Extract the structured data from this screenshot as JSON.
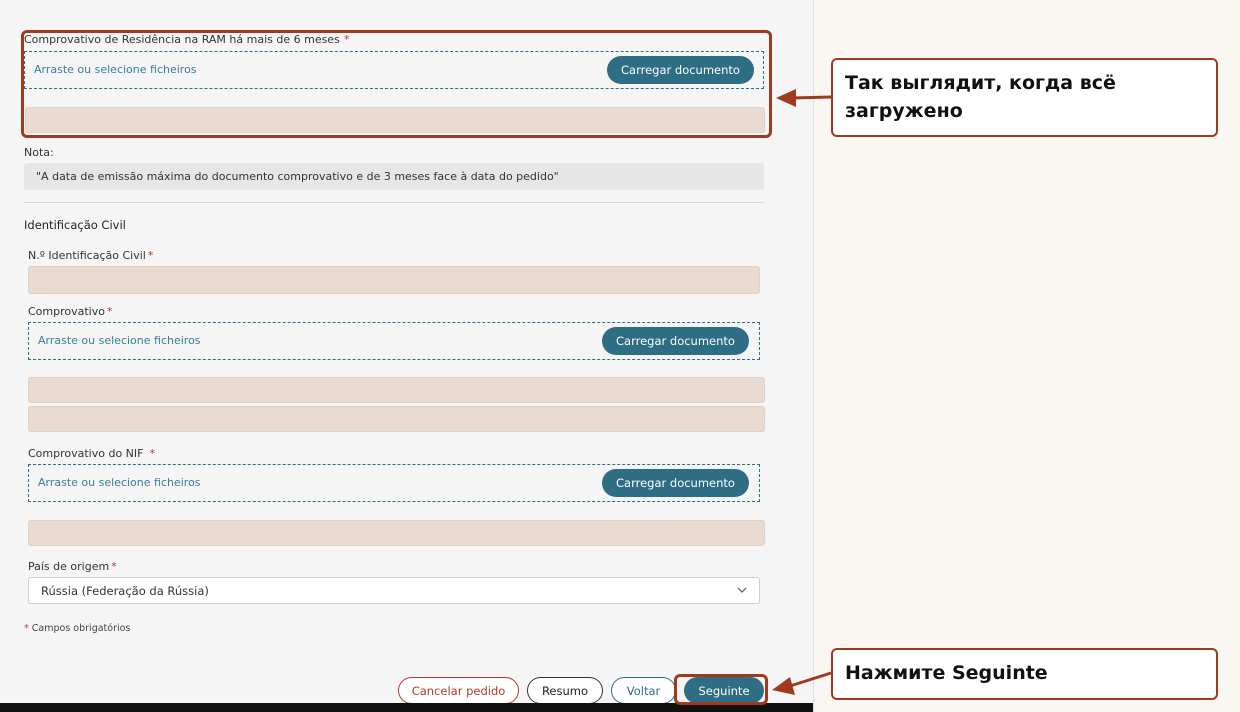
{
  "form": {
    "residence_label": "Comprovativo de Residência na RAM há mais de 6 meses",
    "required_mark": "*",
    "dropzone_hint": "Arraste ou selecione ficheiros",
    "upload_button": "Carregar documento",
    "note_label": "Nota:",
    "note_text": "\"A data de emissão máxima do documento comprovativo e de 3 meses face à data do pedido\"",
    "section_title": "Identificação Civil",
    "civil_id_label": "N.º Identificação Civil",
    "proof_label": "Comprovativo",
    "nif_label": "Comprovativo do NIF",
    "country_label": "País de origem",
    "country_value": "Rússia (Federação da Rússia)",
    "required_note": "Campos obrigatórios"
  },
  "footer": {
    "cancel": "Cancelar pedido",
    "summary": "Resumo",
    "back": "Voltar",
    "next": "Seguinte"
  },
  "callouts": {
    "uploaded": "Так выглядит, когда всё загружено",
    "press_next": "Нажмите Seguinte"
  },
  "colors": {
    "accent": "#2e6e84",
    "annotation": "#a03a1e",
    "cancel": "#b0392b",
    "file_bar": "#e9dbcf"
  }
}
